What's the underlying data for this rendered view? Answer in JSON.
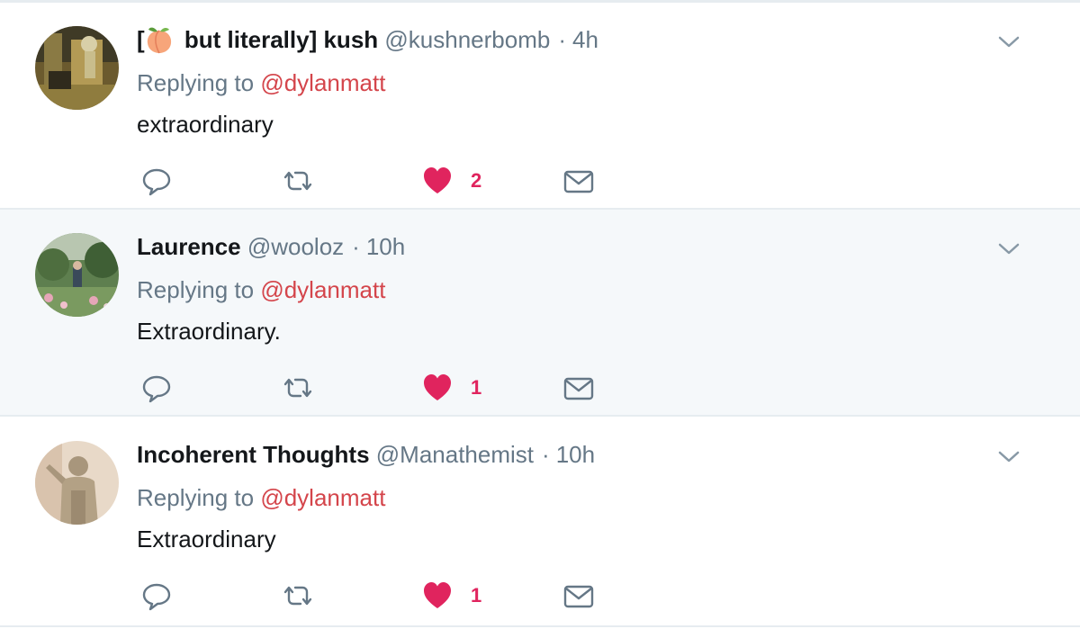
{
  "tweets": [
    {
      "name_prefix": "[",
      "name_emoji": "peach-emoji",
      "name_suffix": " but literally] kush",
      "handle": "@kushnerbomb",
      "time": "4h",
      "replying_prefix": "Replying to ",
      "replying_to": "@dylanmatt",
      "text": "extraordinary",
      "likes": "2",
      "highlighted": false
    },
    {
      "name": "Laurence",
      "handle": "@wooloz",
      "time": "10h",
      "replying_prefix": "Replying to ",
      "replying_to": "@dylanmatt",
      "text": "Extraordinary.",
      "likes": "1",
      "highlighted": true
    },
    {
      "name": "Incoherent Thoughts",
      "handle": "@Manathemist",
      "time": "10h",
      "replying_prefix": "Replying to ",
      "replying_to": "@dylanmatt",
      "text": "Extraordinary",
      "likes": "1",
      "highlighted": false
    }
  ],
  "separator": "·",
  "icons": {
    "reply": "reply-icon",
    "retweet": "retweet-icon",
    "like": "heart-icon",
    "dm": "envelope-icon",
    "more": "chevron-down-icon"
  },
  "colors": {
    "mention": "#d4454b",
    "like": "#e0245e",
    "meta": "#657786",
    "text": "#14171a",
    "highlight_bg": "#f5f8fa"
  }
}
